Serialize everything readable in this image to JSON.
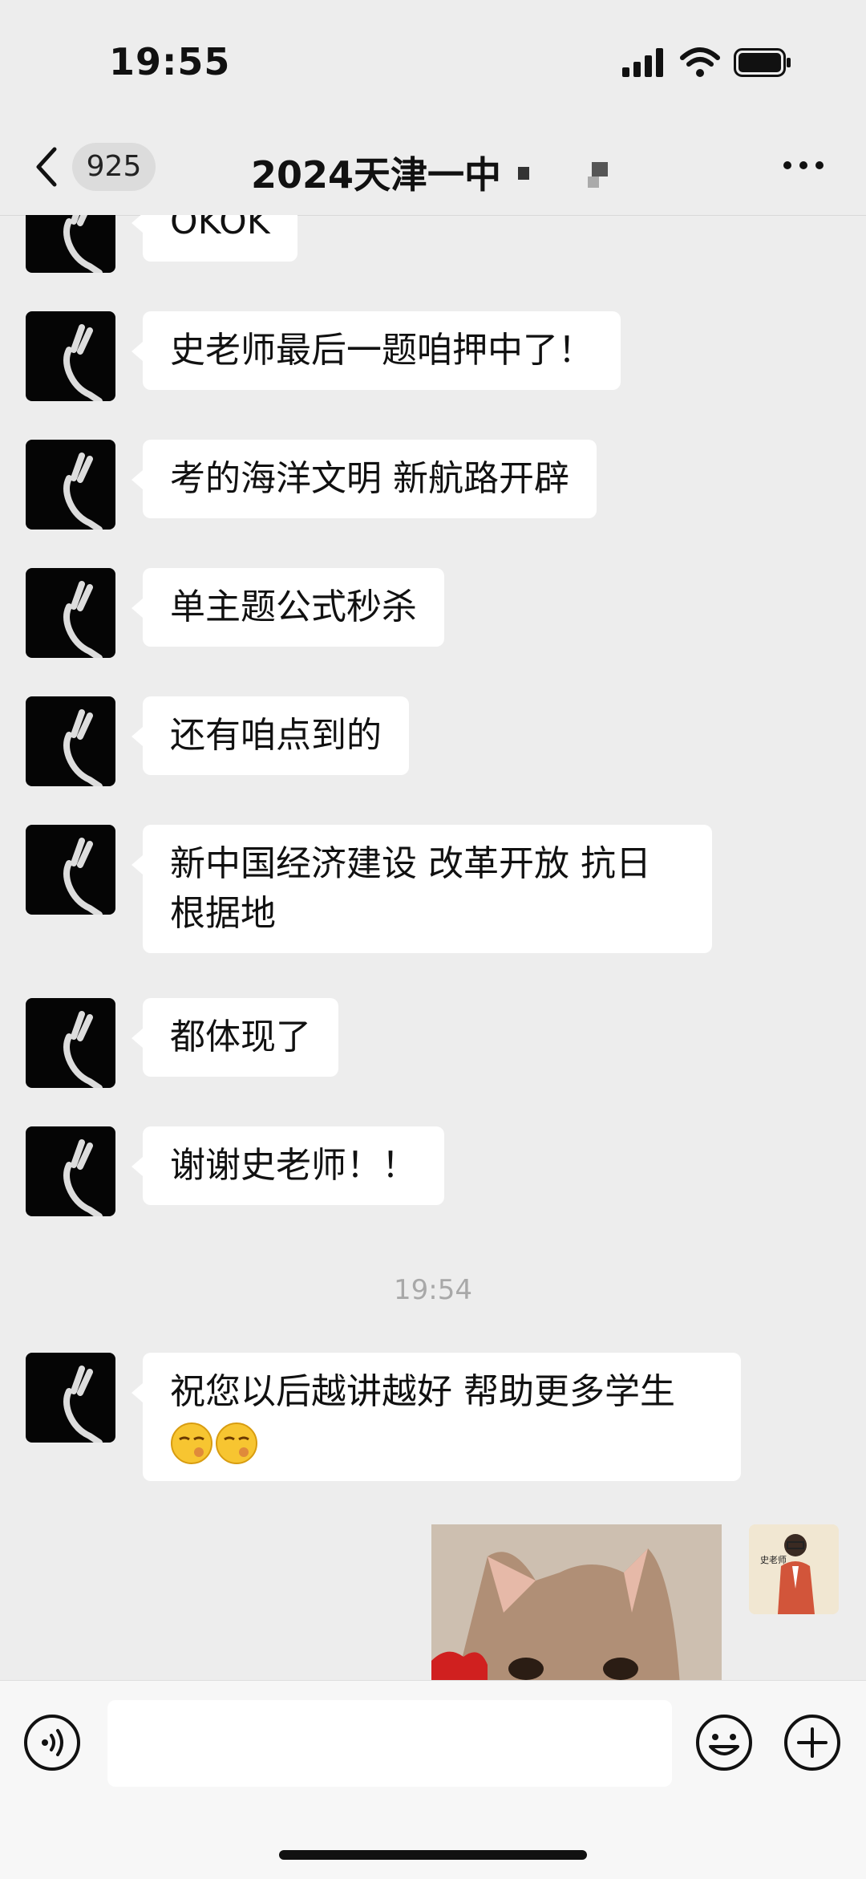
{
  "status_bar": {
    "time": "19:55"
  },
  "nav": {
    "unread_count": "925",
    "title": "2024天津一中"
  },
  "messages": [
    {
      "text": "OKOK"
    },
    {
      "text": "史老师最后一题咱押中了！"
    },
    {
      "text": "考的海洋文明 新航路开辟"
    },
    {
      "text": "单主题公式秒杀"
    },
    {
      "text": "还有咱点到的"
    },
    {
      "text": "新中国经济建设 改革开放 抗日根据地"
    },
    {
      "text": "都体现了"
    },
    {
      "text": "谢谢史老师！！"
    },
    {
      "text": "祝您以后越讲越好 帮助更多学生"
    }
  ],
  "timestamp": "19:54",
  "my_avatar": {
    "label": "史老师"
  },
  "input": {
    "placeholder": ""
  },
  "icons": {
    "back": "chevron-left-icon",
    "more": "more-dots-icon",
    "voice": "voice-icon",
    "emoji": "emoji-face-icon",
    "plus": "plus-circle-icon"
  },
  "colors": {
    "background": "#ededed",
    "bubble": "#ffffff",
    "timestamp": "#a8a8a8"
  }
}
